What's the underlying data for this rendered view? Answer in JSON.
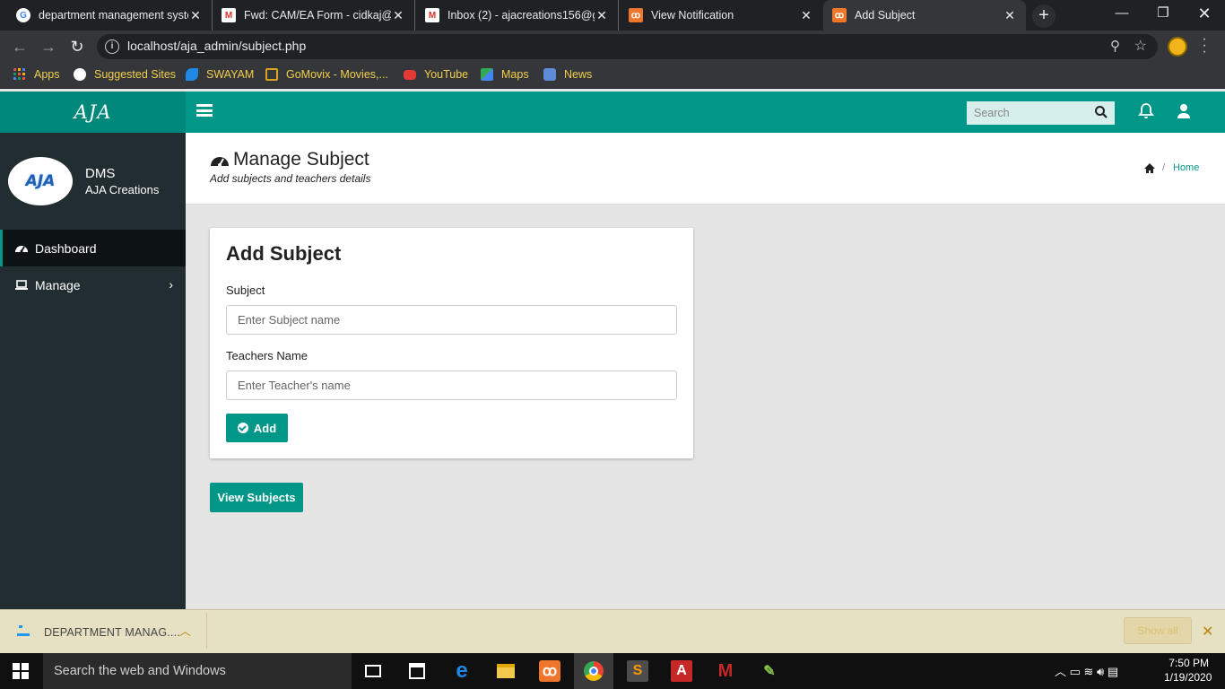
{
  "browser": {
    "tabs": [
      {
        "title": "department management syste",
        "favicon": "google-icon"
      },
      {
        "title": "Fwd: CAM/EA Form - cidkaj@g",
        "favicon": "gmail-icon"
      },
      {
        "title": "Inbox (2) - ajacreations156@gr",
        "favicon": "gmail-icon"
      },
      {
        "title": "View Notification",
        "favicon": "xampp-icon"
      },
      {
        "title": "Add Subject",
        "favicon": "xampp-icon",
        "active": true
      }
    ],
    "url": "localhost/aja_admin/subject.php",
    "bookmarks": [
      {
        "label": "Apps",
        "icon": "apps-grid-icon"
      },
      {
        "label": "Suggested Sites",
        "icon": "suggested-sites-icon"
      },
      {
        "label": "SWAYAM",
        "icon": "swayam-icon"
      },
      {
        "label": "GoMovix - Movies,...",
        "icon": "film-icon"
      },
      {
        "label": "YouTube",
        "icon": "youtube-icon"
      },
      {
        "label": "Maps",
        "icon": "maps-icon"
      },
      {
        "label": "News",
        "icon": "news-icon"
      }
    ]
  },
  "app": {
    "logo": "AJA",
    "search_placeholder": "Search",
    "user": {
      "name": "DMS",
      "org": "AJA Creations",
      "avatar_text": "AJA"
    },
    "sidebar": [
      {
        "label": "Dashboard",
        "icon": "dashboard-icon",
        "active": true
      },
      {
        "label": "Manage",
        "icon": "laptop-icon",
        "has_submenu": true
      }
    ],
    "page": {
      "title": "Manage Subject",
      "subtitle": "Add subjects and teachers details",
      "breadcrumb": "Home"
    },
    "form": {
      "title": "Add Subject",
      "subject_label": "Subject",
      "subject_placeholder": "Enter Subject name",
      "subject_value": "",
      "teacher_label": "Teachers Name",
      "teacher_placeholder": "Enter Teacher's name",
      "teacher_value": "",
      "add_button": "Add"
    },
    "view_button": "View Subjects"
  },
  "download_bar": {
    "file": "DEPARTMENT MANAG....",
    "show_all": "Show all"
  },
  "taskbar": {
    "search_placeholder": "Search the web and Windows",
    "time": "7:50 PM",
    "date": "1/19/2020"
  },
  "colors": {
    "accent": "#009688",
    "sidebar": "#222d32",
    "bookmark_text": "#f2d04b"
  }
}
